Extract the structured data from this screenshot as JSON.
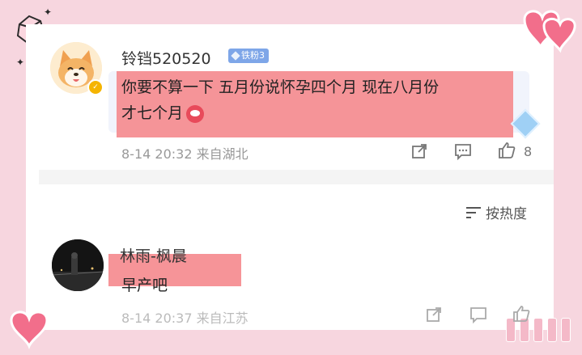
{
  "comments": [
    {
      "username": "铃铛520520",
      "badge": "铁粉3",
      "text_line1": "你要不算一下 五月份说怀孕四个月 现在八月份",
      "text_line2": "才七个月",
      "time": "8-14 20:32 来自湖北",
      "likes": "8"
    },
    {
      "username": "林雨-枫晨",
      "text": "早产吧",
      "time": "8-14 20:37 来自江苏"
    }
  ],
  "sort_label": "按热度",
  "icons": {
    "share": "share-icon",
    "comment": "comment-icon",
    "like": "thumbs-up-icon",
    "sort": "sort-icon"
  },
  "colors": {
    "highlight": "#f58b8f",
    "background": "#f7d6df",
    "badge": "#7ea6e8"
  }
}
